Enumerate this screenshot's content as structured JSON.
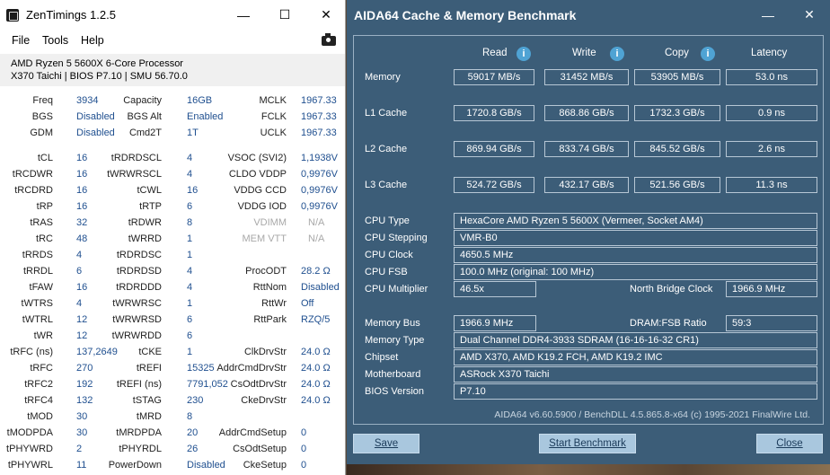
{
  "zentimings": {
    "title": "ZenTimings 1.2.5",
    "menu": [
      "File",
      "Tools",
      "Help"
    ],
    "cpu_name": "AMD Ryzen 5 5600X 6-Core Processor",
    "board_info": "X370 Taichi | BIOS P7.10 | SMU 56.70.0",
    "rows": [
      [
        "Freq",
        "3934",
        "Capacity",
        "16GB",
        "MCLK",
        "1967.33"
      ],
      [
        "BGS",
        "Disabled",
        "BGS Alt",
        "Enabled",
        "FCLK",
        "1967.33"
      ],
      [
        "GDM",
        "Disabled",
        "Cmd2T",
        "1T",
        "UCLK",
        "1967.33"
      ],
      [
        "tCL",
        "16",
        "tRDRDSCL",
        "4",
        "VSOC (SVI2)",
        "1,1938V"
      ],
      [
        "tRCDWR",
        "16",
        "tWRWRSCL",
        "4",
        "CLDO VDDP",
        "0,9976V"
      ],
      [
        "tRCDRD",
        "16",
        "tCWL",
        "16",
        "VDDG CCD",
        "0,9976V"
      ],
      [
        "tRP",
        "16",
        "tRTP",
        "6",
        "VDDG IOD",
        "0,9976V"
      ],
      [
        "tRAS",
        "32",
        "tRDWR",
        "8",
        "VDIMM",
        "N/A"
      ],
      [
        "tRC",
        "48",
        "tWRRD",
        "1",
        "MEM VTT",
        "N/A"
      ],
      [
        "tRRDS",
        "4",
        "tRDRDSC",
        "1",
        "",
        ""
      ],
      [
        "tRRDL",
        "6",
        "tRDRDSD",
        "4",
        "ProcODT",
        "28.2 Ω"
      ],
      [
        "tFAW",
        "16",
        "tRDRDDD",
        "4",
        "RttNom",
        "Disabled"
      ],
      [
        "tWTRS",
        "4",
        "tWRWRSC",
        "1",
        "RttWr",
        "Off"
      ],
      [
        "tWTRL",
        "12",
        "tWRWRSD",
        "6",
        "RttPark",
        "RZQ/5"
      ],
      [
        "tWR",
        "12",
        "tWRWRDD",
        "6",
        "",
        ""
      ],
      [
        "tRFC (ns)",
        "137,2649",
        "tCKE",
        "1",
        "ClkDrvStr",
        "24.0 Ω"
      ],
      [
        "tRFC",
        "270",
        "tREFI",
        "15325",
        "AddrCmdDrvStr",
        "24.0 Ω"
      ],
      [
        "tRFC2",
        "192",
        "tREFI (ns)",
        "7791,052",
        "CsOdtDrvStr",
        "24.0 Ω"
      ],
      [
        "tRFC4",
        "132",
        "tSTAG",
        "230",
        "CkeDrvStr",
        "24.0 Ω"
      ],
      [
        "tMOD",
        "30",
        "tMRD",
        "8",
        "",
        ""
      ],
      [
        "tMODPDA",
        "30",
        "tMRDPDA",
        "20",
        "AddrCmdSetup",
        "0"
      ],
      [
        "tPHYWRD",
        "2",
        "tPHYRDL",
        "26",
        "CsOdtSetup",
        "0"
      ],
      [
        "tPHYWRL",
        "11",
        "PowerDown",
        "Disabled",
        "CkeSetup",
        "0"
      ]
    ]
  },
  "aida": {
    "title": "AIDA64 Cache & Memory Benchmark",
    "headers": {
      "read": "Read",
      "write": "Write",
      "copy": "Copy",
      "latency": "Latency"
    },
    "bench_rows": [
      {
        "label": "Memory",
        "read": "59017 MB/s",
        "write": "31452 MB/s",
        "copy": "53905 MB/s",
        "latency": "53.0 ns"
      },
      {
        "label": "L1 Cache",
        "read": "1720.8 GB/s",
        "write": "868.86 GB/s",
        "copy": "1732.3 GB/s",
        "latency": "0.9 ns"
      },
      {
        "label": "L2 Cache",
        "read": "869.94 GB/s",
        "write": "833.74 GB/s",
        "copy": "845.52 GB/s",
        "latency": "2.6 ns"
      },
      {
        "label": "L3 Cache",
        "read": "524.72 GB/s",
        "write": "432.17 GB/s",
        "copy": "521.56 GB/s",
        "latency": "11.3 ns"
      }
    ],
    "cpu_type_label": "CPU Type",
    "cpu_type": "HexaCore AMD Ryzen 5 5600X  (Vermeer, Socket AM4)",
    "cpu_stepping_label": "CPU Stepping",
    "cpu_stepping": "VMR-B0",
    "cpu_clock_label": "CPU Clock",
    "cpu_clock": "4650.5 MHz",
    "cpu_fsb_label": "CPU FSB",
    "cpu_fsb": "100.0 MHz  (original: 100 MHz)",
    "cpu_mult_label": "CPU Multiplier",
    "cpu_mult": "46.5x",
    "nb_clock_label": "North Bridge Clock",
    "nb_clock": "1966.9 MHz",
    "mem_bus_label": "Memory Bus",
    "mem_bus": "1966.9 MHz",
    "dram_fsb_label": "DRAM:FSB Ratio",
    "dram_fsb": "59:3",
    "mem_type_label": "Memory Type",
    "mem_type": "Dual Channel DDR4-3933 SDRAM  (16-16-16-32 CR1)",
    "chipset_label": "Chipset",
    "chipset": "AMD X370, AMD K19.2 FCH, AMD K19.2 IMC",
    "motherboard_label": "Motherboard",
    "motherboard": "ASRock X370 Taichi",
    "bios_label": "BIOS Version",
    "bios": "P7.10",
    "footer": "AIDA64 v6.60.5900 / BenchDLL 4.5.865.8-x64  (c) 1995-2021 FinalWire Ltd.",
    "save": "Save",
    "start": "Start Benchmark",
    "close": "Close"
  }
}
